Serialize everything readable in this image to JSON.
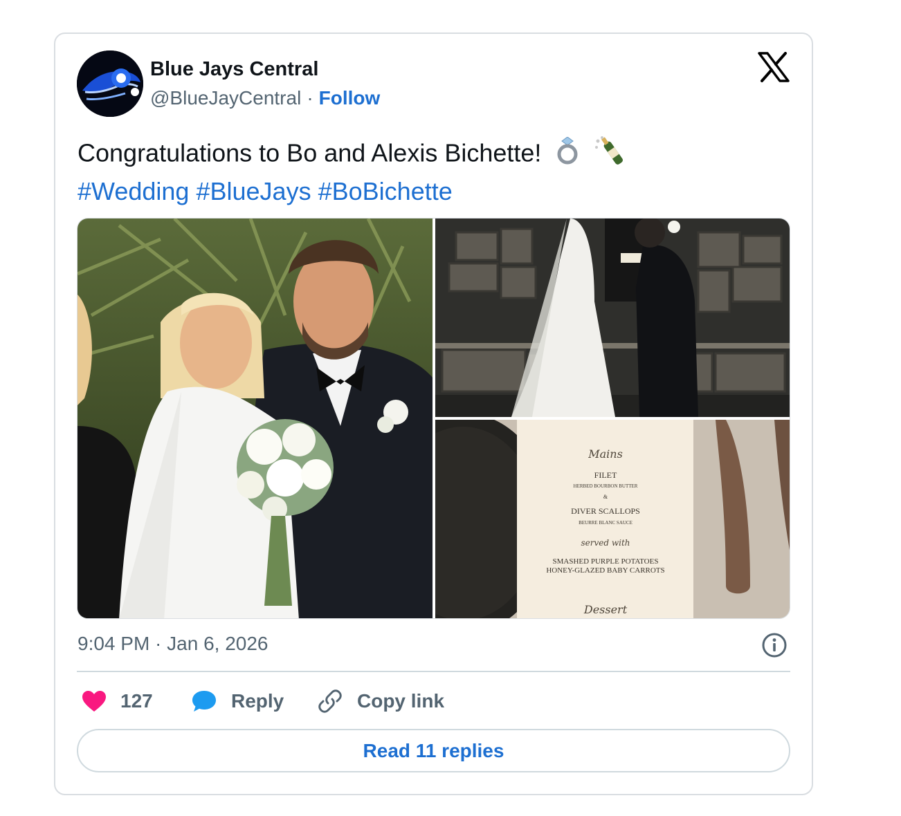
{
  "author": {
    "name": "Blue Jays Central",
    "handle": "@BlueJayCentral",
    "separator": "·",
    "follow_label": "Follow"
  },
  "tweet": {
    "text": "Congratulations to Bo and Alexis Bichette!",
    "emojis": [
      "ring-emoji",
      "champagne-emoji"
    ],
    "hashtags": [
      "#Wedding",
      "#BlueJays",
      "#BoBichette"
    ]
  },
  "media": {
    "menu_card": {
      "section_mains": "Mains",
      "item1": "FILET",
      "item1_desc": "HERBED BOURBON BUTTER",
      "amp": "&",
      "item2": "DIVER SCALLOPS",
      "item2_desc": "BEURRE BLANC SAUCE",
      "served_with": "served with",
      "side1": "SMASHED PURPLE POTATOES",
      "side2": "HONEY-GLAZED BABY CARROTS",
      "section_dessert": "Dessert"
    }
  },
  "meta": {
    "timestamp": "9:04 PM · Jan 6, 2026"
  },
  "actions": {
    "likes": "127",
    "reply_label": "Reply",
    "copy_link_label": "Copy link",
    "read_replies_label": "Read 11 replies"
  },
  "colors": {
    "link_blue": "#1d6fd1",
    "heart": "#f91880",
    "reply_bubble": "#1d9bf0",
    "text_dark": "#0f1419",
    "text_muted": "#536471"
  }
}
